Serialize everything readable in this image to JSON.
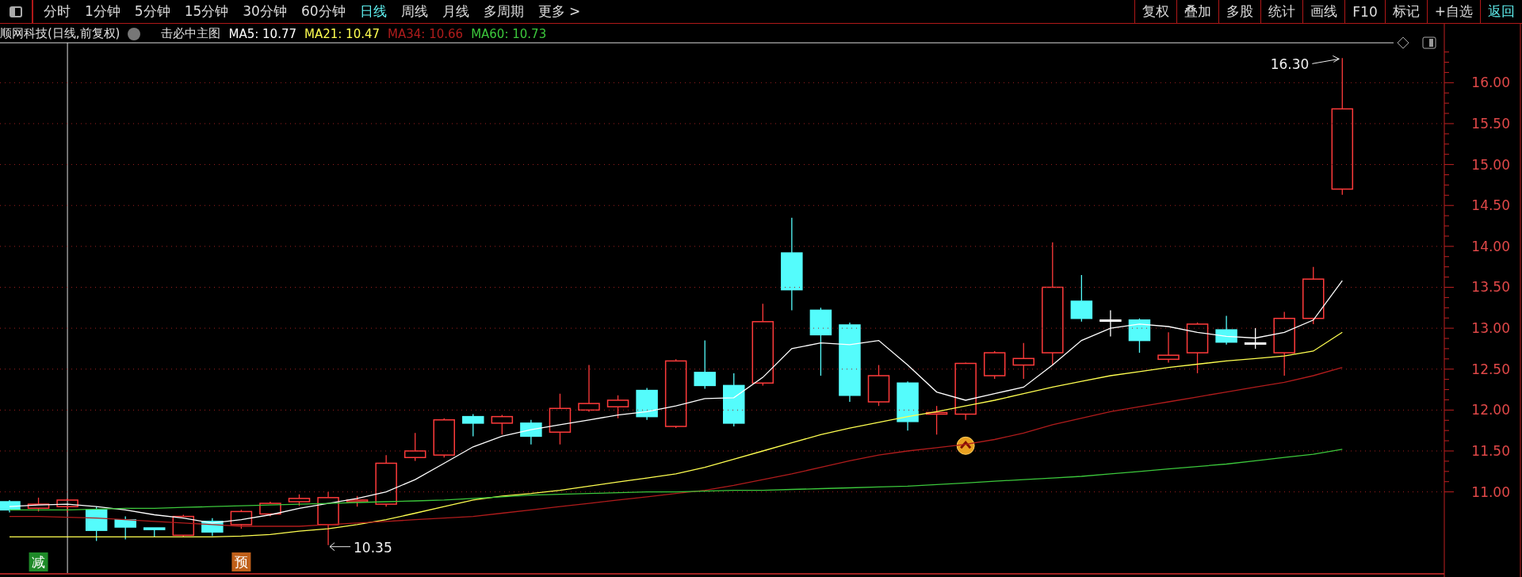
{
  "toolbar": {
    "periods": [
      {
        "label": "分时",
        "selected": false
      },
      {
        "label": "1分钟",
        "selected": false
      },
      {
        "label": "5分钟",
        "selected": false
      },
      {
        "label": "15分钟",
        "selected": false
      },
      {
        "label": "30分钟",
        "selected": false
      },
      {
        "label": "60分钟",
        "selected": false
      },
      {
        "label": "日线",
        "selected": true
      },
      {
        "label": "周线",
        "selected": false
      },
      {
        "label": "月线",
        "selected": false
      },
      {
        "label": "多周期",
        "selected": false
      },
      {
        "label": "更多 >",
        "selected": false
      }
    ],
    "actions": [
      {
        "label": "复权",
        "selected": false
      },
      {
        "label": "叠加",
        "selected": false
      },
      {
        "label": "多股",
        "selected": false
      },
      {
        "label": "统计",
        "selected": false
      },
      {
        "label": "画线",
        "selected": false
      },
      {
        "label": "F10",
        "selected": false
      },
      {
        "label": "标记",
        "selected": false
      },
      {
        "label": "+自选",
        "selected": false
      },
      {
        "label": "返回",
        "selected": true
      }
    ]
  },
  "chart": {
    "title": "顺网科技(日线,前复权)",
    "indicator": "击必中主图",
    "legend": [
      {
        "label": "MA5: 10.77"
      },
      {
        "label": "MA21: 10.47"
      },
      {
        "label": "MA34: 10.66"
      },
      {
        "label": "MA60: 10.73"
      }
    ],
    "chart_data": {
      "type": "line",
      "ylim": [
        9.96,
        16.72
      ],
      "grid": true,
      "yticks": [
        {
          "value": 11,
          "label": "11.00"
        },
        {
          "value": 11.5,
          "label": "11.50"
        },
        {
          "value": 12,
          "label": "12.00"
        },
        {
          "value": 12.5,
          "label": "12.50"
        },
        {
          "value": 13,
          "label": "13.00"
        },
        {
          "value": 13.5,
          "label": "13.50"
        },
        {
          "value": 14,
          "label": "14.00"
        },
        {
          "value": 14.5,
          "label": "14.50"
        },
        {
          "value": 15,
          "label": "15.00"
        },
        {
          "value": 15.5,
          "label": "15.50"
        },
        {
          "value": 16,
          "label": "16.00"
        }
      ],
      "series": [
        {
          "color": "#ffffff",
          "values": [
            10.82,
            10.84,
            10.85,
            10.82,
            10.78,
            10.72,
            10.68,
            10.62,
            10.66,
            10.72,
            10.8,
            10.86,
            10.92,
            11.0,
            11.15,
            11.35,
            11.55,
            11.68,
            11.76,
            11.82,
            11.88,
            11.94,
            11.98,
            12.05,
            12.14,
            12.15,
            12.4,
            12.75,
            12.82,
            12.8,
            12.85,
            12.55,
            12.22,
            12.12,
            12.2,
            12.28,
            12.55,
            12.85,
            13.0,
            13.05,
            13.02,
            12.95,
            12.9,
            12.88,
            12.95,
            13.1,
            13.58
          ]
        },
        {
          "color": "#ffff50",
          "values": [
            10.45,
            10.45,
            10.45,
            10.45,
            10.45,
            10.45,
            10.45,
            10.45,
            10.46,
            10.48,
            10.52,
            10.55,
            10.6,
            10.66,
            10.74,
            10.82,
            10.9,
            10.95,
            10.98,
            11.02,
            11.07,
            11.12,
            11.17,
            11.22,
            11.3,
            11.4,
            11.5,
            11.6,
            11.7,
            11.78,
            11.85,
            11.92,
            11.98,
            12.05,
            12.12,
            12.2,
            12.28,
            12.35,
            12.42,
            12.47,
            12.52,
            12.56,
            12.6,
            12.63,
            12.66,
            12.72,
            12.95
          ]
        },
        {
          "color": "#b01c1c",
          "values": [
            10.7,
            10.7,
            10.69,
            10.68,
            10.66,
            10.64,
            10.62,
            10.6,
            10.58,
            10.58,
            10.58,
            10.6,
            10.62,
            10.64,
            10.66,
            10.68,
            10.7,
            10.74,
            10.78,
            10.82,
            10.86,
            10.9,
            10.94,
            10.98,
            11.02,
            11.08,
            11.15,
            11.22,
            11.3,
            11.38,
            11.45,
            11.5,
            11.54,
            11.58,
            11.64,
            11.72,
            11.82,
            11.9,
            11.98,
            12.04,
            12.1,
            12.16,
            12.22,
            12.28,
            12.34,
            12.42,
            12.52
          ]
        },
        {
          "color": "#3cc83c",
          "values": [
            10.78,
            10.78,
            10.78,
            10.79,
            10.8,
            10.8,
            10.81,
            10.82,
            10.83,
            10.84,
            10.85,
            10.86,
            10.87,
            10.88,
            10.89,
            10.9,
            10.92,
            10.94,
            10.96,
            10.97,
            10.98,
            10.99,
            11.0,
            11.0,
            11.01,
            11.02,
            11.02,
            11.03,
            11.04,
            11.05,
            11.06,
            11.07,
            11.09,
            11.11,
            11.13,
            11.15,
            11.17,
            11.19,
            11.22,
            11.25,
            11.28,
            11.31,
            11.34,
            11.38,
            11.42,
            11.46,
            11.52
          ]
        }
      ],
      "annotations": [
        "16.30",
        "10.35"
      ]
    },
    "signals": [
      {
        "text": "减",
        "color": "#1e8a28"
      },
      {
        "text": "预",
        "color": "#c0601a"
      }
    ]
  }
}
